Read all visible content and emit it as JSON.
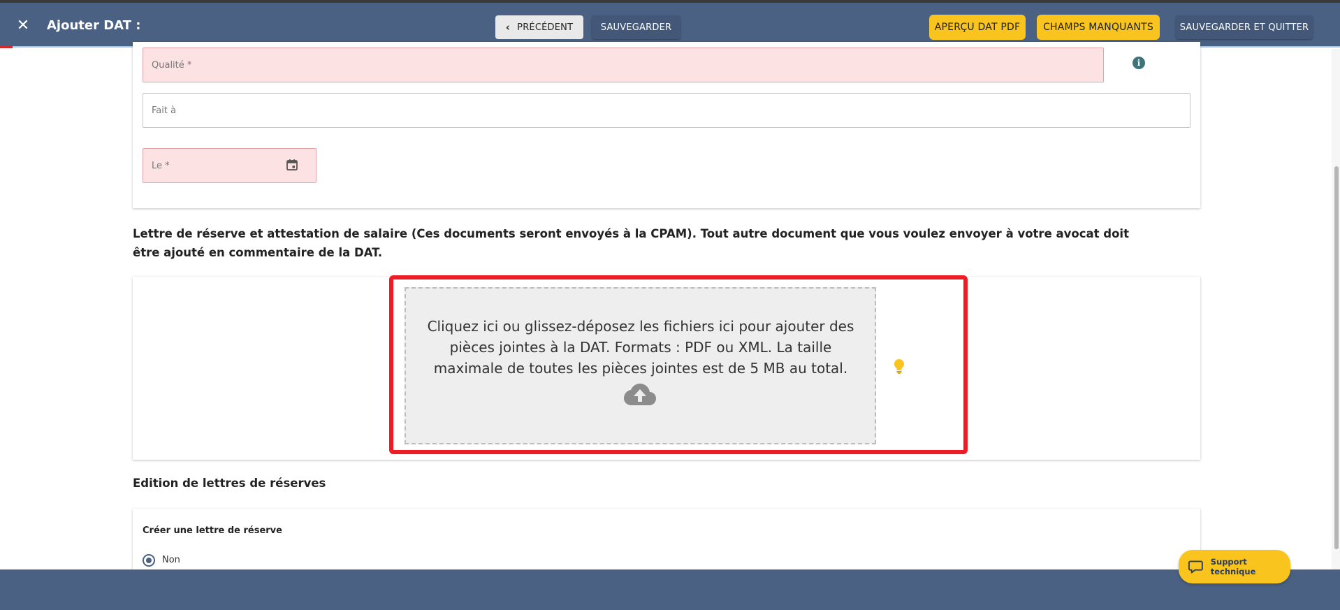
{
  "header": {
    "close_glyph": "✕",
    "title": "Ajouter DAT :",
    "prev_label": "PRÉCÉDENT",
    "save_label": "SAUVEGARDER",
    "pdf_label": "APERÇU DAT PDF",
    "missing_label": "CHAMPS MANQUANTS",
    "save_quit_label": "SAUVEGARDER ET QUITTER"
  },
  "form": {
    "qualite_placeholder": "Qualité *",
    "fait_placeholder": "Fait à",
    "le_placeholder": "Le *"
  },
  "attachments": {
    "section_text": "Lettre de réserve et attestation de salaire (Ces documents seront envoyés à la CPAM). Tout autre document que vous voulez envoyer à votre avocat doit être ajouté en commentaire de la DAT.",
    "dropzone_text": "Cliquez ici ou glissez-déposez les fichiers ici pour ajouter des pièces jointes à la DAT. Formats : PDF ou XML. La taille maximale de toutes les pièces jointes est de 5 MB au total."
  },
  "reserves": {
    "section_title": "Edition de lettres de réserves",
    "create_label": "Créer une lettre de réserve",
    "radio_option": "Non"
  },
  "support": {
    "label": "Support technique"
  },
  "colors": {
    "header": "#4a6183",
    "accent_yellow": "#f9c41d",
    "error_field": "#fde2e4",
    "highlight_red": "#ee1c24"
  },
  "icons": [
    "close-icon",
    "chevron-left-icon",
    "info-icon",
    "calendar-icon",
    "cloud-upload-icon",
    "lightbulb-icon",
    "chat-bubble-icon"
  ]
}
